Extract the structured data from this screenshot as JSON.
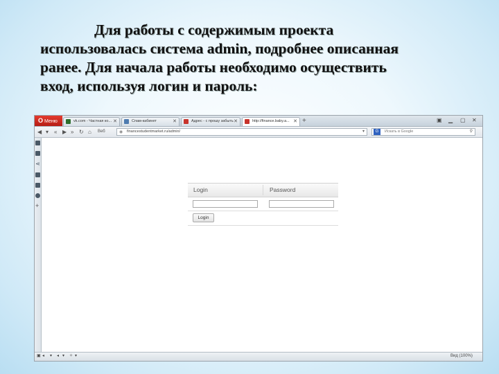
{
  "caption": {
    "line1": "Для работы с содержимым проекта",
    "line2": "использовалась  система admin, подробнее описанная",
    "line3": "ранее.  Для начала работы необходимо осуществить",
    "line4": "вход, используя логин и пароль:"
  },
  "browser": {
    "menu_label": "Меню",
    "tabs": [
      {
        "label": "vk.com - Частная ко...",
        "color": "#2d6e2d"
      },
      {
        "label": "Спам-кабинет",
        "color": "#4e7bb0"
      },
      {
        "label": "Адрес - с прошу забыть",
        "color": "#c8332b"
      },
      {
        "label": "http://finance.baby.a...",
        "color": "#c8332b"
      }
    ],
    "new_tab_symbol": "+",
    "address_label": "Веб",
    "url": "financestudentmarket.ru/admin/",
    "search_placeholder": "Искать в Google",
    "search_engine_letter": "G",
    "status": {
      "left_items": [
        "▣",
        "◂",
        "▾",
        "◂",
        "▾",
        "✧",
        "▾"
      ],
      "zoom": "Вид (100%)"
    }
  },
  "login_form": {
    "login_label": "Login",
    "password_label": "Password",
    "login_value": "",
    "password_value": "",
    "button_label": "Login"
  }
}
